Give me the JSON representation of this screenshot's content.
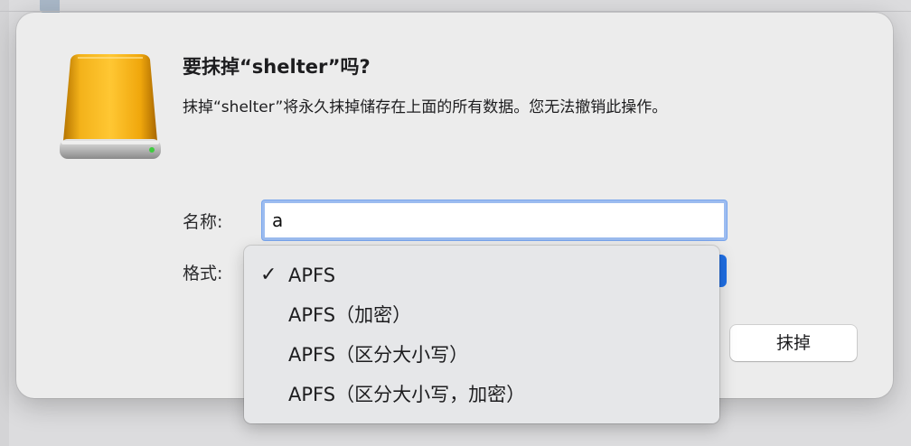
{
  "dialog": {
    "title": "要抹掉“shelter”吗?",
    "message": "抹掉“shelter”将永久抹掉储存在上面的所有数据。您无法撤销此操作。",
    "name_label": "名称:",
    "name_value": "a",
    "format_label": "格式:",
    "erase_button": "抹掉"
  },
  "format_menu": {
    "selected_index": 0,
    "options": [
      {
        "label": "APFS",
        "checked": true
      },
      {
        "label": "APFS（加密）",
        "checked": false
      },
      {
        "label": "APFS（区分大小写）",
        "checked": false
      },
      {
        "label": "APFS（区分大小写，加密）",
        "checked": false
      }
    ],
    "check_glyph": "✓"
  },
  "icons": {
    "disk": "external-drive-icon"
  },
  "colors": {
    "focus_ring": "#9cbcf0",
    "select_accent": "#1f6fe5",
    "drive_body": "#f0a800",
    "drive_led": "#3ecb3e"
  }
}
